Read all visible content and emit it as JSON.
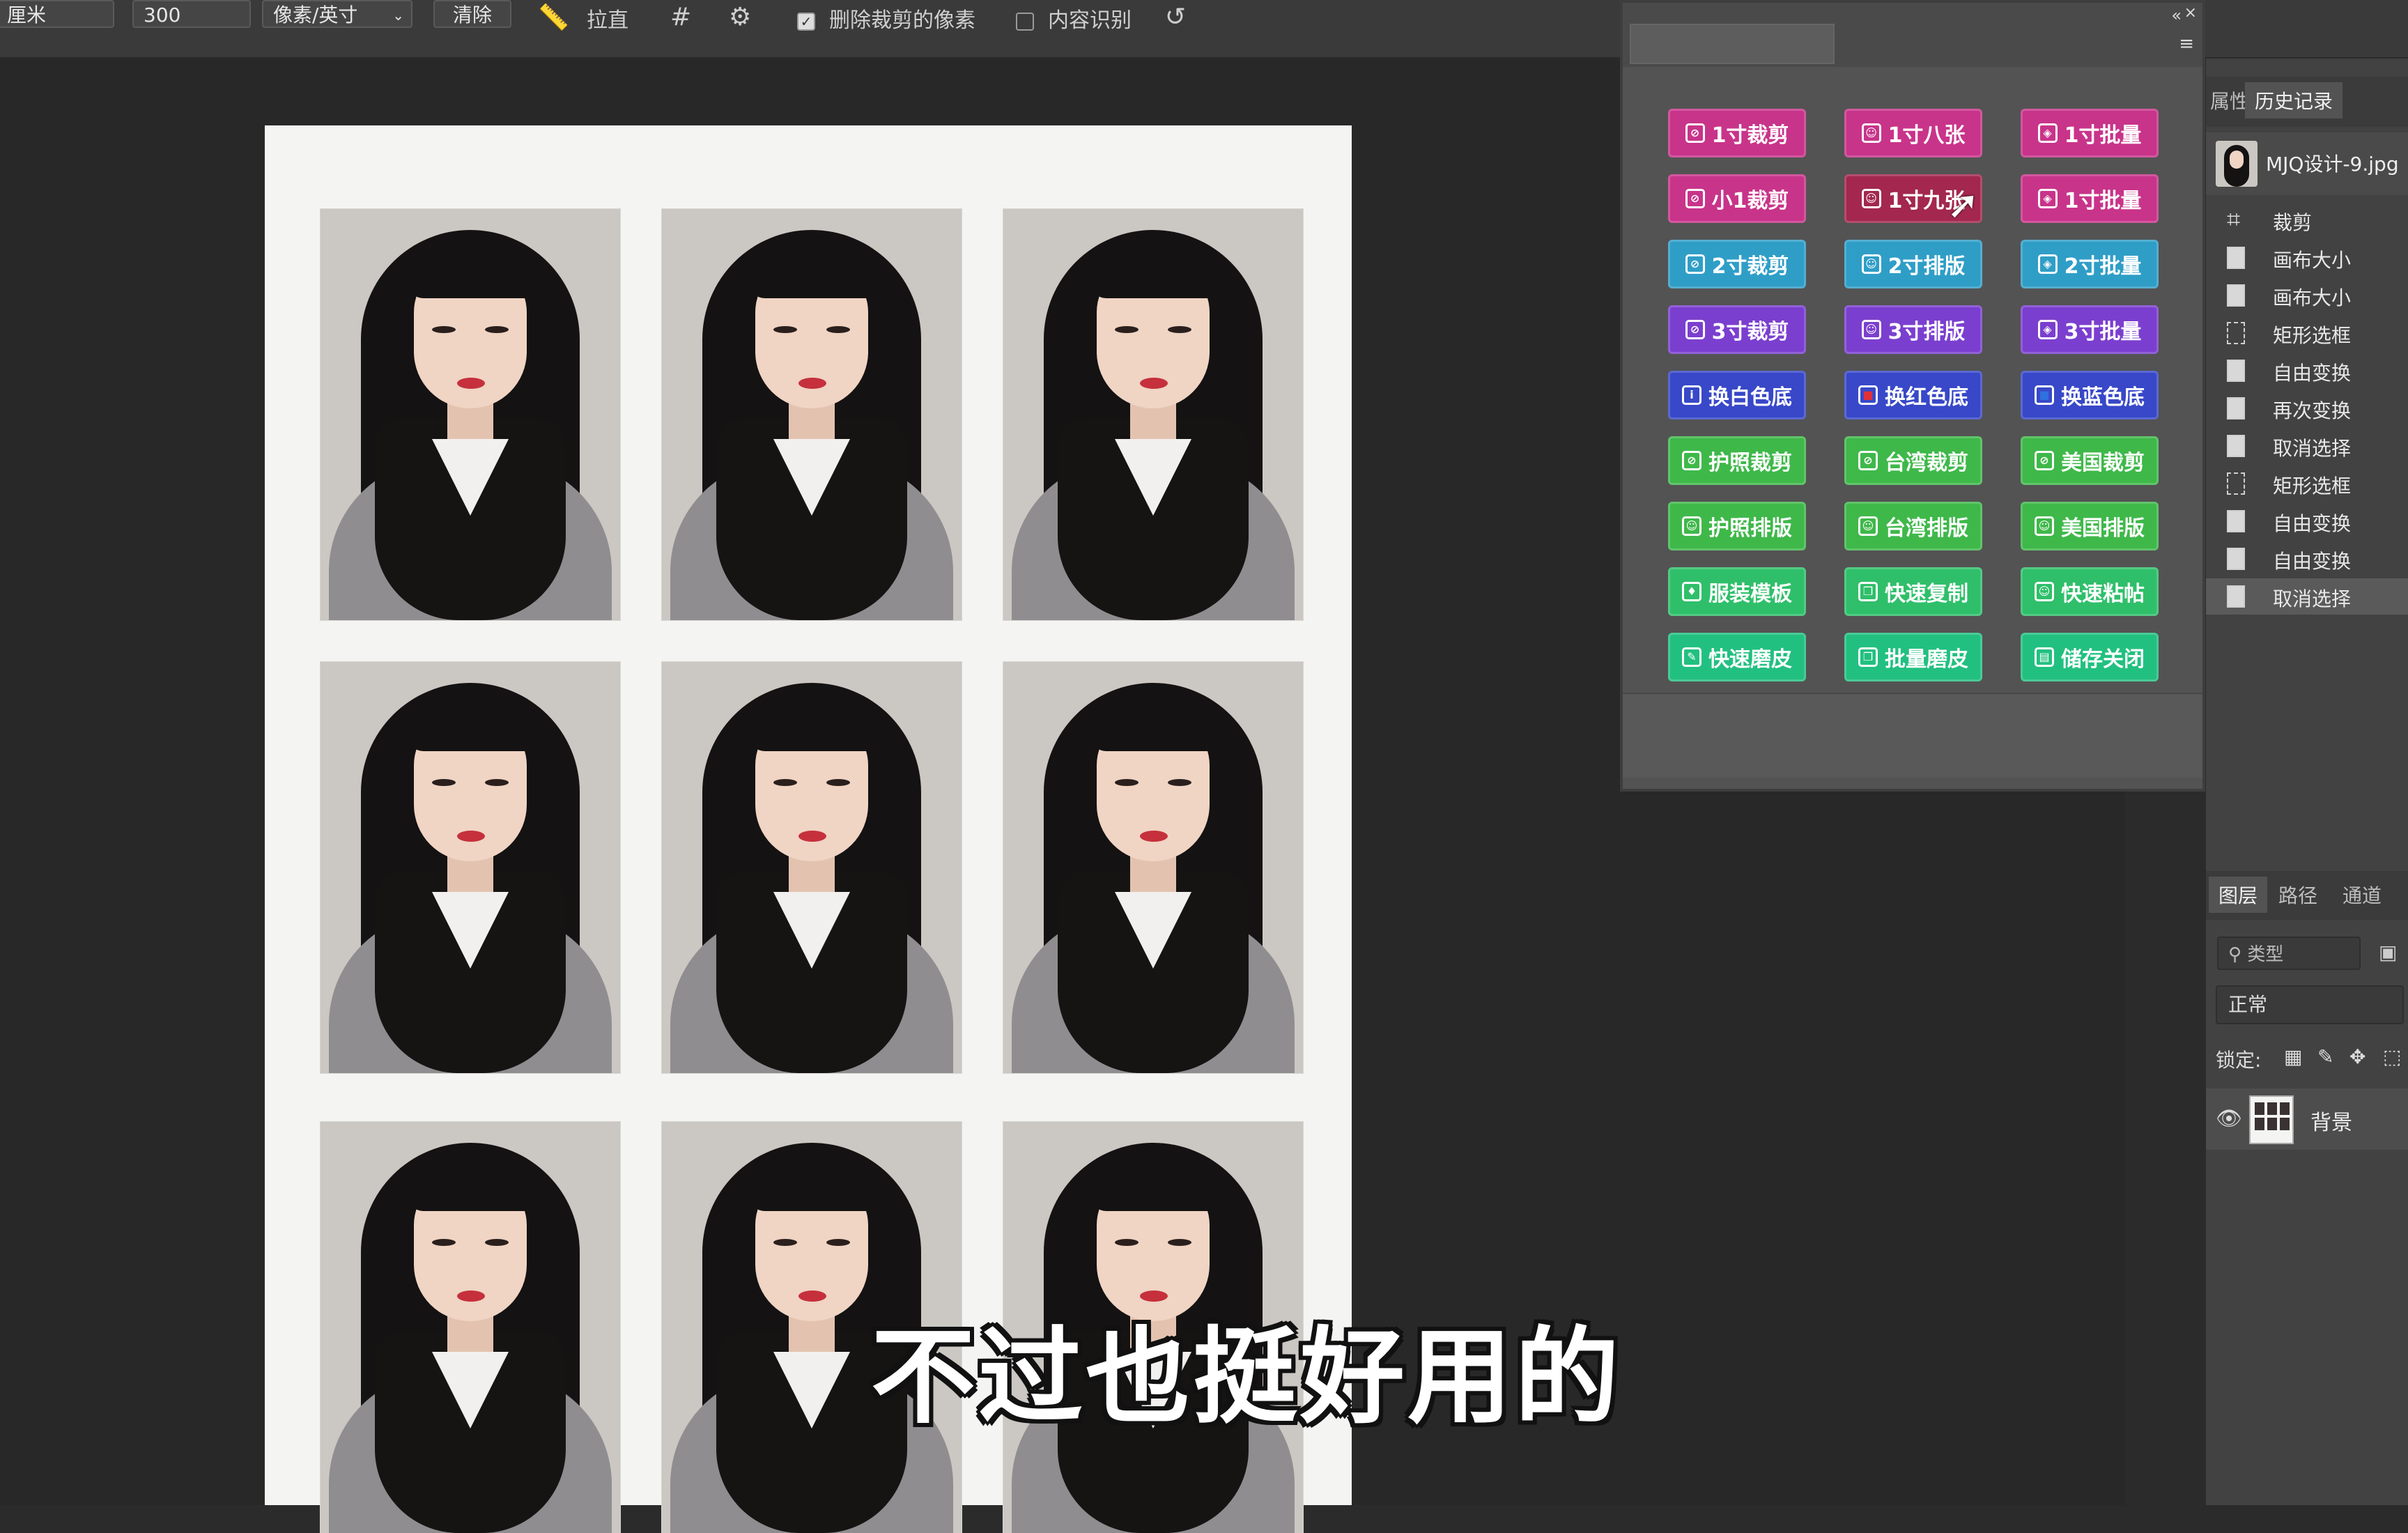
{
  "options_bar": {
    "unit_field": "厘米",
    "resolution_value": "300",
    "resolution_unit": "像素/英寸",
    "clear_label": "清除",
    "straighten_label": "拉直",
    "delete_cropped_label": "删除裁剪的像素",
    "delete_cropped_checked": true,
    "content_aware_label": "内容识别",
    "content_aware_checked": false
  },
  "plugin_panel": {
    "buttons": [
      {
        "label": "1寸裁剪",
        "icon": "crop-icon",
        "color": "#c8348a"
      },
      {
        "label": "1寸八张",
        "icon": "person-icon",
        "color": "#c8348a"
      },
      {
        "label": "1寸批量",
        "icon": "cube-icon",
        "color": "#c8348a"
      },
      {
        "label": "小1裁剪",
        "icon": "crop-icon",
        "color": "#c8348a"
      },
      {
        "label": "1寸九张",
        "icon": "person-icon",
        "color": "#a3274f"
      },
      {
        "label": "1寸批量",
        "icon": "cube-icon",
        "color": "#c8348a"
      },
      {
        "label": "2寸裁剪",
        "icon": "crop-icon",
        "color": "#2f9ec7"
      },
      {
        "label": "2寸排版",
        "icon": "person-icon",
        "color": "#2f9ec7"
      },
      {
        "label": "2寸批量",
        "icon": "cube-icon",
        "color": "#2f9ec7"
      },
      {
        "label": "3寸裁剪",
        "icon": "crop-icon",
        "color": "#7b3fcf"
      },
      {
        "label": "3寸排版",
        "icon": "person-icon",
        "color": "#7b3fcf"
      },
      {
        "label": "3寸批量",
        "icon": "cube-icon",
        "color": "#7b3fcf"
      },
      {
        "label": "换白色底",
        "icon": "info-icon",
        "color": "#3848c8"
      },
      {
        "label": "换红色底",
        "icon": "red-square-icon",
        "color": "#3848c8"
      },
      {
        "label": "换蓝色底",
        "icon": "blue-square-icon",
        "color": "#3848c8"
      },
      {
        "label": "护照裁剪",
        "icon": "crop-icon",
        "color": "#3fb84a"
      },
      {
        "label": "台湾裁剪",
        "icon": "crop-icon",
        "color": "#3fb84a"
      },
      {
        "label": "美国裁剪",
        "icon": "crop-icon",
        "color": "#3fb84a"
      },
      {
        "label": "护照排版",
        "icon": "person-icon",
        "color": "#3fb84a"
      },
      {
        "label": "台湾排版",
        "icon": "person-icon",
        "color": "#3fb84a"
      },
      {
        "label": "美国排版",
        "icon": "person-icon",
        "color": "#3fb84a"
      },
      {
        "label": "服装模板",
        "icon": "shirt-icon",
        "color": "#2fbf6a"
      },
      {
        "label": "快速复制",
        "icon": "copy-icon",
        "color": "#2fbf6a"
      },
      {
        "label": "快速粘帖",
        "icon": "paste-icon",
        "color": "#2fbf6a"
      },
      {
        "label": "快速磨皮",
        "icon": "brush-icon",
        "color": "#22c080"
      },
      {
        "label": "批量磨皮",
        "icon": "copy-icon",
        "color": "#22c080"
      },
      {
        "label": "储存关闭",
        "icon": "save-icon",
        "color": "#22c080"
      }
    ]
  },
  "history_panel": {
    "tab_properties": "属性",
    "tab_history": "历史记录",
    "snapshot_name": "MJQ设计-9.jpg",
    "items": [
      {
        "label": "裁剪",
        "icon": "crop-icon"
      },
      {
        "label": "画布大小",
        "icon": "doc-icon"
      },
      {
        "label": "画布大小",
        "icon": "doc-icon"
      },
      {
        "label": "矩形选框",
        "icon": "marquee-icon"
      },
      {
        "label": "自由变换",
        "icon": "doc-icon"
      },
      {
        "label": "再次变换",
        "icon": "doc-icon"
      },
      {
        "label": "取消选择",
        "icon": "doc-icon"
      },
      {
        "label": "矩形选框",
        "icon": "marquee-icon"
      },
      {
        "label": "自由变换",
        "icon": "doc-icon"
      },
      {
        "label": "自由变换",
        "icon": "doc-icon"
      },
      {
        "label": "取消选择",
        "icon": "doc-icon"
      }
    ]
  },
  "layers_panel": {
    "tab_layers": "图层",
    "tab_paths": "路径",
    "tab_channels": "通道",
    "search_placeholder": "类型",
    "blend_mode": "正常",
    "lock_label": "锁定:",
    "layer_name": "背景"
  },
  "subtitle": "不过也挺好用的"
}
